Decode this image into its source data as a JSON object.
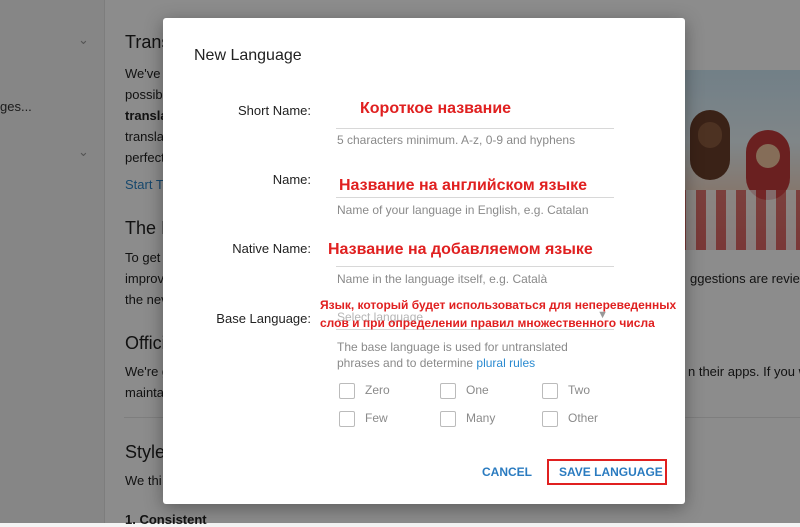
{
  "background": {
    "sidebar_text": "ges...",
    "heading1": "Trans",
    "para1": [
      "We've",
      "possib",
      "transla",
      "transla",
      "perfect"
    ],
    "link1": "Start T",
    "heading2": "The I",
    "para2": [
      "To get",
      "improv",
      "the nev"
    ],
    "para2_right": "ggestions are reviewed",
    "heading3": "Offici",
    "para3": [
      "We're g",
      "mainta"
    ],
    "para3_right": "n their apps. If you w",
    "heading4": "Style",
    "para4": "We thi",
    "heading5": "1. Consistent"
  },
  "dialog": {
    "title": "New Language",
    "fields": {
      "short_name": {
        "label": "Short Name:",
        "value": "",
        "hint": "5 characters minimum. A-z, 0-9 and hyphens",
        "annotation": "Короткое название"
      },
      "name": {
        "label": "Name:",
        "value": "",
        "hint": "Name of your language in English, e.g. Catalan",
        "annotation": "Название на английском языке"
      },
      "native_name": {
        "label": "Native Name:",
        "value": "",
        "hint": "Name in the language itself, e.g. Català",
        "annotation": "Название на добавляемом языке"
      },
      "base_language": {
        "label": "Base Language:",
        "placeholder": "Select language",
        "hint_prefix": "The base language is used for untranslated phrases and to determine ",
        "hint_link": "plural rules",
        "annotation_line1": "Язык, который будет использоваться для непереведенных",
        "annotation_line2": "слов и при определении правил множественного числа"
      }
    },
    "plural_forms": [
      "Zero",
      "One",
      "Two",
      "Few",
      "Many",
      "Other"
    ],
    "buttons": {
      "cancel": "CANCEL",
      "save": "SAVE LANGUAGE"
    },
    "colors": {
      "annotation": "#e02020",
      "button": "#2a7bc0",
      "link": "#2a8ad0"
    }
  }
}
